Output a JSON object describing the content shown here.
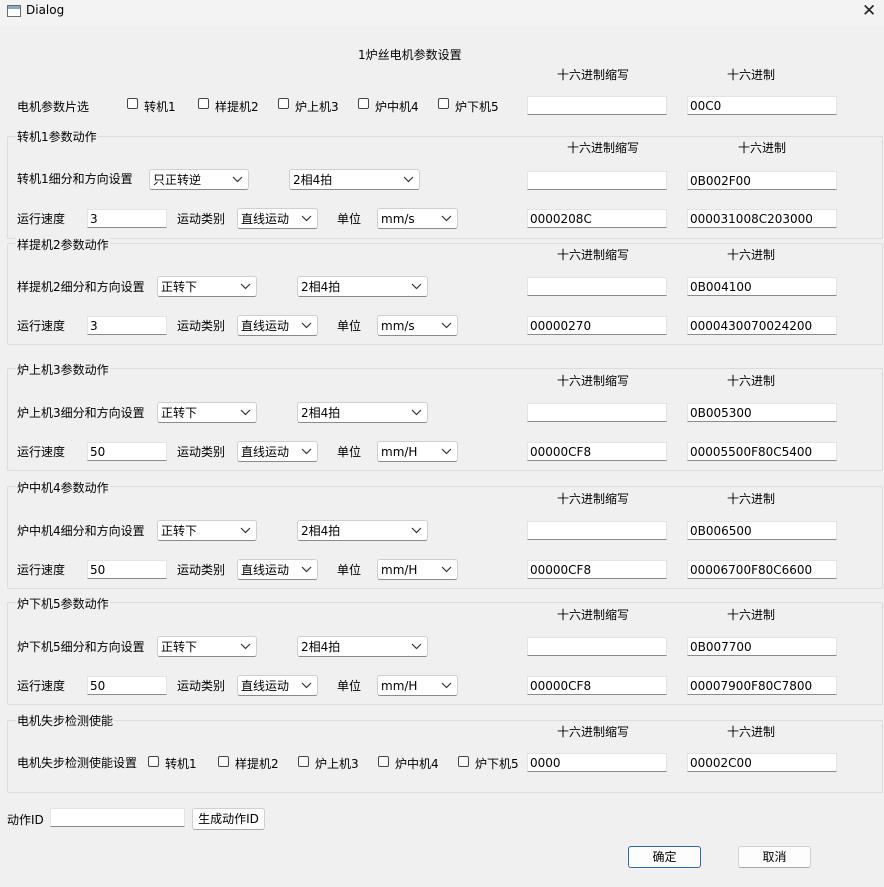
{
  "window": {
    "title": "Dialog"
  },
  "header": {
    "title": "1炉丝电机参数设置",
    "hex_short_label": "十六进制缩写",
    "hex_label": "十六进制"
  },
  "select_row": {
    "label": "电机参数片选",
    "options": [
      "转机1",
      "样提机2",
      "炉上机3",
      "炉中机4",
      "炉下机5"
    ],
    "hex_short": "",
    "hex": "00C0"
  },
  "groups": [
    {
      "legend": "转机1参数动作",
      "hex_short_label": "十六进制缩写",
      "hex_label": "十六进制",
      "dir_label": "转机1细分和方向设置",
      "direction": "只正转逆",
      "steps": "2相4拍",
      "dir_hex_short": "",
      "dir_hex": "0B002F00",
      "speed_label": "运行速度",
      "speed": "3",
      "motion_label": "运动类别",
      "motion": "直线运动",
      "unit_label": "单位",
      "unit": "mm/s",
      "speed_hex_short": "0000208C",
      "speed_hex": "000031008C203000"
    },
    {
      "legend": "样提机2参数动作",
      "hex_short_label": "十六进制缩写",
      "hex_label": "十六进制",
      "dir_label": "样提机2细分和方向设置",
      "direction": "正转下",
      "steps": "2相4拍",
      "dir_hex_short": "",
      "dir_hex": "0B004100",
      "speed_label": "运行速度",
      "speed": "3",
      "motion_label": "运动类别",
      "motion": "直线运动",
      "unit_label": "单位",
      "unit": "mm/s",
      "speed_hex_short": "00000270",
      "speed_hex": "0000430070024200"
    },
    {
      "legend": "炉上机3参数动作",
      "hex_short_label": "十六进制缩写",
      "hex_label": "十六进制",
      "dir_label": "炉上机3细分和方向设置",
      "direction": "正转下",
      "steps": "2相4拍",
      "dir_hex_short": "",
      "dir_hex": "0B005300",
      "speed_label": "运行速度",
      "speed": "50",
      "motion_label": "运动类别",
      "motion": "直线运动",
      "unit_label": "单位",
      "unit": "mm/H",
      "speed_hex_short": "00000CF8",
      "speed_hex": "00005500F80C5400"
    },
    {
      "legend": "炉中机4参数动作",
      "hex_short_label": "十六进制缩写",
      "hex_label": "十六进制",
      "dir_label": "炉中机4细分和方向设置",
      "direction": "正转下",
      "steps": "2相4拍",
      "dir_hex_short": "",
      "dir_hex": "0B006500",
      "speed_label": "运行速度",
      "speed": "50",
      "motion_label": "运动类别",
      "motion": "直线运动",
      "unit_label": "单位",
      "unit": "mm/H",
      "speed_hex_short": "00000CF8",
      "speed_hex": "00006700F80C6600"
    },
    {
      "legend": "炉下机5参数动作",
      "hex_short_label": "十六进制缩写",
      "hex_label": "十六进制",
      "dir_label": "炉下机5细分和方向设置",
      "direction": "正转下",
      "steps": "2相4拍",
      "dir_hex_short": "",
      "dir_hex": "0B007700",
      "speed_label": "运行速度",
      "speed": "50",
      "motion_label": "运动类别",
      "motion": "直线运动",
      "unit_label": "单位",
      "unit": "mm/H",
      "speed_hex_short": "00000CF8",
      "speed_hex": "00007900F80C7800"
    }
  ],
  "step_loss": {
    "legend": "电机失步检测使能",
    "hex_short_label": "十六进制缩写",
    "hex_label": "十六进制",
    "label": "电机失步检测使能设置",
    "options": [
      "转机1",
      "样提机2",
      "炉上机3",
      "炉中机4",
      "炉下机5"
    ],
    "hex_short": "0000",
    "hex": "00002C00"
  },
  "action": {
    "label": "动作ID",
    "value": "",
    "generate_label": "生成动作ID"
  },
  "footer": {
    "ok_label": "确定",
    "cancel_label": "取消"
  }
}
